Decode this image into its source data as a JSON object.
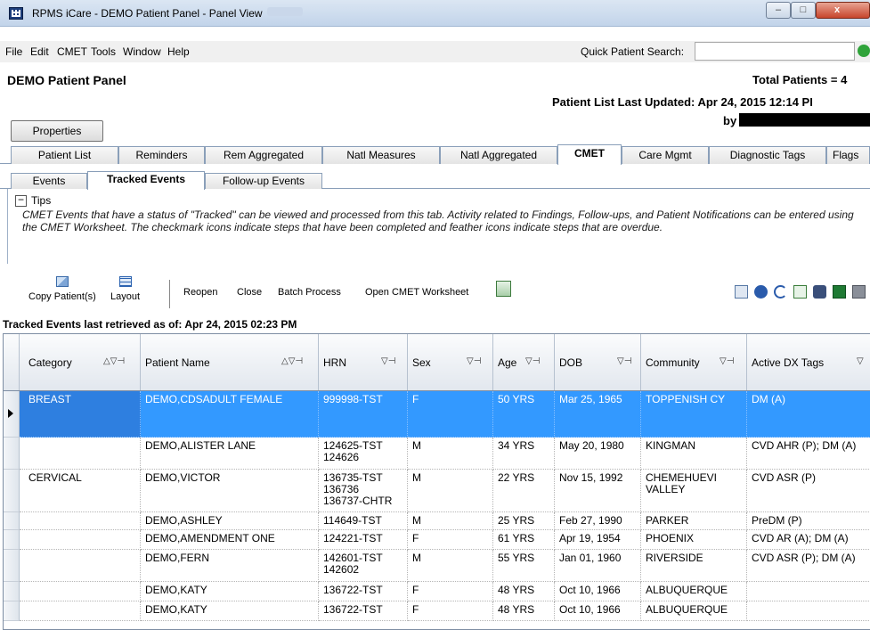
{
  "window": {
    "title": "RPMS iCare - DEMO Patient Panel - Panel View",
    "min": "–",
    "max": "□",
    "close": "x"
  },
  "menu": [
    "File",
    "Edit",
    "CMET",
    "Tools",
    "Window",
    "Help"
  ],
  "quick_search": {
    "label": "Quick Patient Search:",
    "value": ""
  },
  "panel": {
    "title": "DEMO Patient Panel",
    "total": "Total Patients = 4",
    "updated": "Patient List Last Updated: Apr 24, 2015 12:14 PI",
    "by": "by"
  },
  "properties_button": "Properties",
  "tabs": [
    "Patient List",
    "Reminders",
    "Rem Aggregated",
    "Natl Measures",
    "Natl Aggregated",
    "CMET",
    "Care Mgmt",
    "Diagnostic Tags",
    "Flags"
  ],
  "subtabs": [
    "Events",
    "Tracked Events",
    "Follow-up Events"
  ],
  "tips": {
    "toggle": "−",
    "label": "Tips",
    "text": "CMET Events that have a status of \"Tracked\" can be viewed and processed from this tab.  Activity related to Findings, Follow-ups, and Patient Notifications can be entered using the CMET Worksheet.  The checkmark icons indicate steps that have been completed and feather icons indicate steps that are overdue."
  },
  "toolbar": {
    "copy": "Copy Patient(s)",
    "layout": "Layout",
    "reopen": "Reopen",
    "close": "Close",
    "batch": "Batch Process",
    "worksheet": "Open CMET Worksheet"
  },
  "retrieved": "Tracked Events last retrieved as of: Apr 24, 2015 02:23 PM",
  "columns": [
    "Category",
    "Patient Name",
    "HRN",
    "Sex",
    "Age",
    "DOB",
    "Community",
    "Active DX Tags"
  ],
  "rows": [
    {
      "category": "BREAST",
      "name": "DEMO,CDSADULT FEMALE",
      "hrn": "999998-TST",
      "sex": "F",
      "age": "50 YRS",
      "dob": "Mar 25, 1965",
      "community": "TOPPENISH CY",
      "dx": "DM (A)"
    },
    {
      "category": "",
      "name": "DEMO,ALISTER LANE",
      "hrn": "124625-TST\n124626",
      "sex": "M",
      "age": "34 YRS",
      "dob": "May 20, 1980",
      "community": "KINGMAN",
      "dx": "CVD AHR (P); DM (A)"
    },
    {
      "category": "CERVICAL",
      "name": "DEMO,VICTOR",
      "hrn": "136735-TST\n136736\n136737-CHTR",
      "sex": "M",
      "age": "22 YRS",
      "dob": "Nov 15, 1992",
      "community": "CHEMEHUEVI\nVALLEY",
      "dx": "CVD ASR (P)"
    },
    {
      "category": "",
      "name": "DEMO,ASHLEY",
      "hrn": "114649-TST",
      "sex": "M",
      "age": "25 YRS",
      "dob": "Feb 27, 1990",
      "community": "PARKER",
      "dx": "PreDM (P)"
    },
    {
      "category": "",
      "name": "DEMO,AMENDMENT ONE",
      "hrn": "124221-TST",
      "sex": "F",
      "age": "61 YRS",
      "dob": "Apr 19, 1954",
      "community": "PHOENIX",
      "dx": "CVD AR (A); DM (A)"
    },
    {
      "category": "",
      "name": "DEMO,FERN",
      "hrn": "142601-TST\n142602",
      "sex": "M",
      "age": "55 YRS",
      "dob": "Jan 01, 1960",
      "community": "RIVERSIDE",
      "dx": "CVD ASR (P); DM (A)"
    },
    {
      "category": "",
      "name": "DEMO,KATY",
      "hrn": "136722-TST",
      "sex": "F",
      "age": "48 YRS",
      "dob": "Oct 10, 1966",
      "community": "ALBUQUERQUE",
      "dx": ""
    },
    {
      "category": "",
      "name": "DEMO,KATY",
      "hrn": "136722-TST",
      "sex": "F",
      "age": "48 YRS",
      "dob": "Oct 10, 1966",
      "community": "ALBUQUERQUE",
      "dx": ""
    }
  ]
}
